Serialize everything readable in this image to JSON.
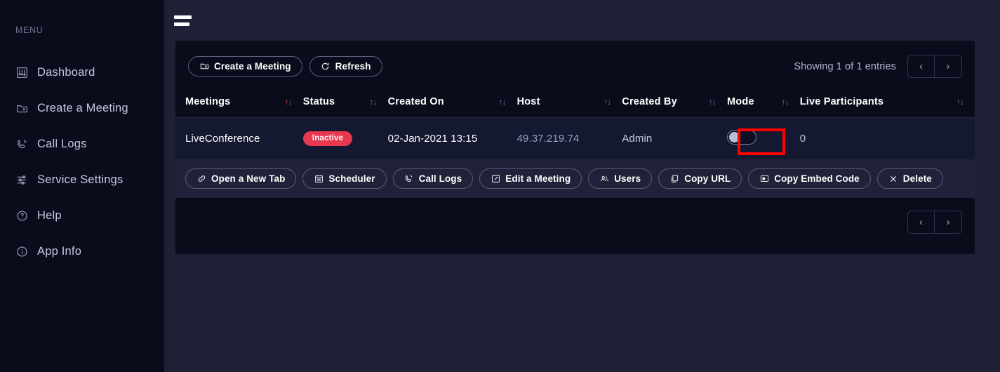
{
  "sidebar": {
    "menu_label": "MENU",
    "items": [
      {
        "label": "Dashboard",
        "icon": "dashboard-icon"
      },
      {
        "label": "Create a Meeting",
        "icon": "folder-plus-icon"
      },
      {
        "label": "Call Logs",
        "icon": "phone-icon"
      },
      {
        "label": "Service Settings",
        "icon": "sliders-icon"
      },
      {
        "label": "Help",
        "icon": "question-circle-icon"
      },
      {
        "label": "App Info",
        "icon": "info-circle-icon"
      }
    ]
  },
  "topbar": {
    "menu_toggle": "hamburger-icon"
  },
  "toolbar": {
    "create_meeting": "Create a Meeting",
    "refresh": "Refresh",
    "entries_text": "Showing 1 of 1 entries",
    "prev": "‹",
    "next": "›"
  },
  "table": {
    "columns": [
      {
        "label": "Meetings",
        "sort_active": true
      },
      {
        "label": "Status",
        "sort_active": false
      },
      {
        "label": "Created On",
        "sort_active": false
      },
      {
        "label": "Host",
        "sort_active": false
      },
      {
        "label": "Created By",
        "sort_active": false
      },
      {
        "label": "Mode",
        "sort_active": false
      },
      {
        "label": "Live Participants",
        "sort_active": false
      }
    ],
    "rows": [
      {
        "meeting": "LiveConference",
        "status": "Inactive",
        "created_on": "02-Jan-2021 13:15",
        "host": "49.37.219.74",
        "created_by": "Admin",
        "mode_on": false,
        "live_participants": "0"
      }
    ]
  },
  "actions": [
    {
      "label": "Open a New Tab",
      "icon": "link-icon"
    },
    {
      "label": "Scheduler",
      "icon": "calendar-icon"
    },
    {
      "label": "Call Logs",
      "icon": "phone-icon"
    },
    {
      "label": "Edit a Meeting",
      "icon": "edit-icon"
    },
    {
      "label": "Users",
      "icon": "users-icon"
    },
    {
      "label": "Copy URL",
      "icon": "copy-icon"
    },
    {
      "label": "Copy Embed Code",
      "icon": "embed-icon"
    },
    {
      "label": "Delete",
      "icon": "close-icon"
    }
  ],
  "colors": {
    "sidebar_bg": "#0a0c1c",
    "page_bg": "#1e2035",
    "card_bg": "#0a0c1c",
    "row_bg": "#141830",
    "action_bar_bg": "#1f2238",
    "badge_red": "#e8384f",
    "sort_active": "#ea4335",
    "annotation_red": "#ff0000"
  }
}
